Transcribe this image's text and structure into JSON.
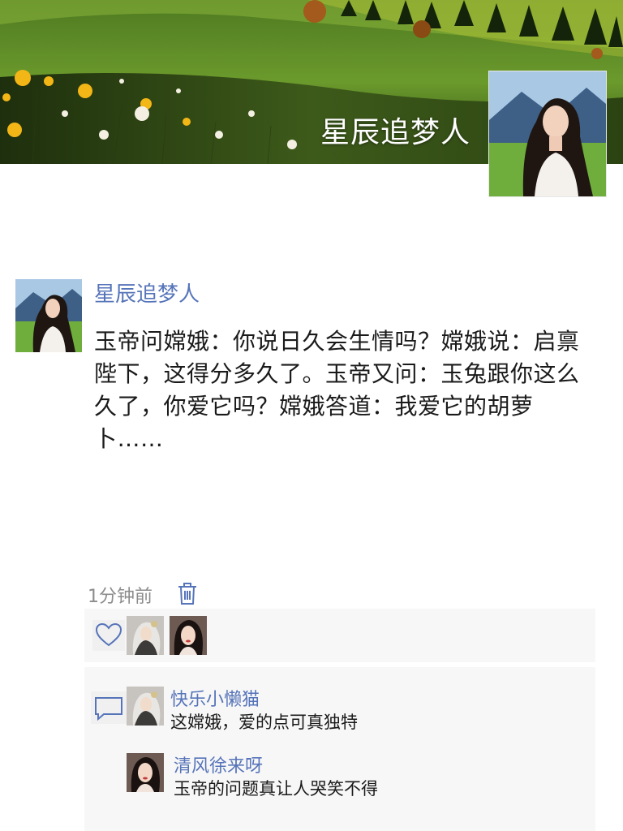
{
  "cover": {
    "name": "星辰追梦人"
  },
  "post": {
    "author": "星辰追梦人",
    "text": "玉帝问嫦娥：你说日久会生情吗？嫦娥说：启禀陛下，这得分多久了。玉帝又问：玉兔跟你这么久了，你爱它吗？嫦娥答道：我爱它的胡萝卜……",
    "time": "1分钟前"
  },
  "likes": {
    "icon": "heart-outline-icon"
  },
  "comments": [
    {
      "author": "快乐小懒猫",
      "text": "这嫦娥，爱的点可真独特"
    },
    {
      "author": "清风徐来呀",
      "text": "玉帝的问题真让人哭笑不得"
    }
  ],
  "colors": {
    "name_link": "#5674b9",
    "panel_bg": "#f7f7f7",
    "meta_text": "#8c8c8c"
  }
}
